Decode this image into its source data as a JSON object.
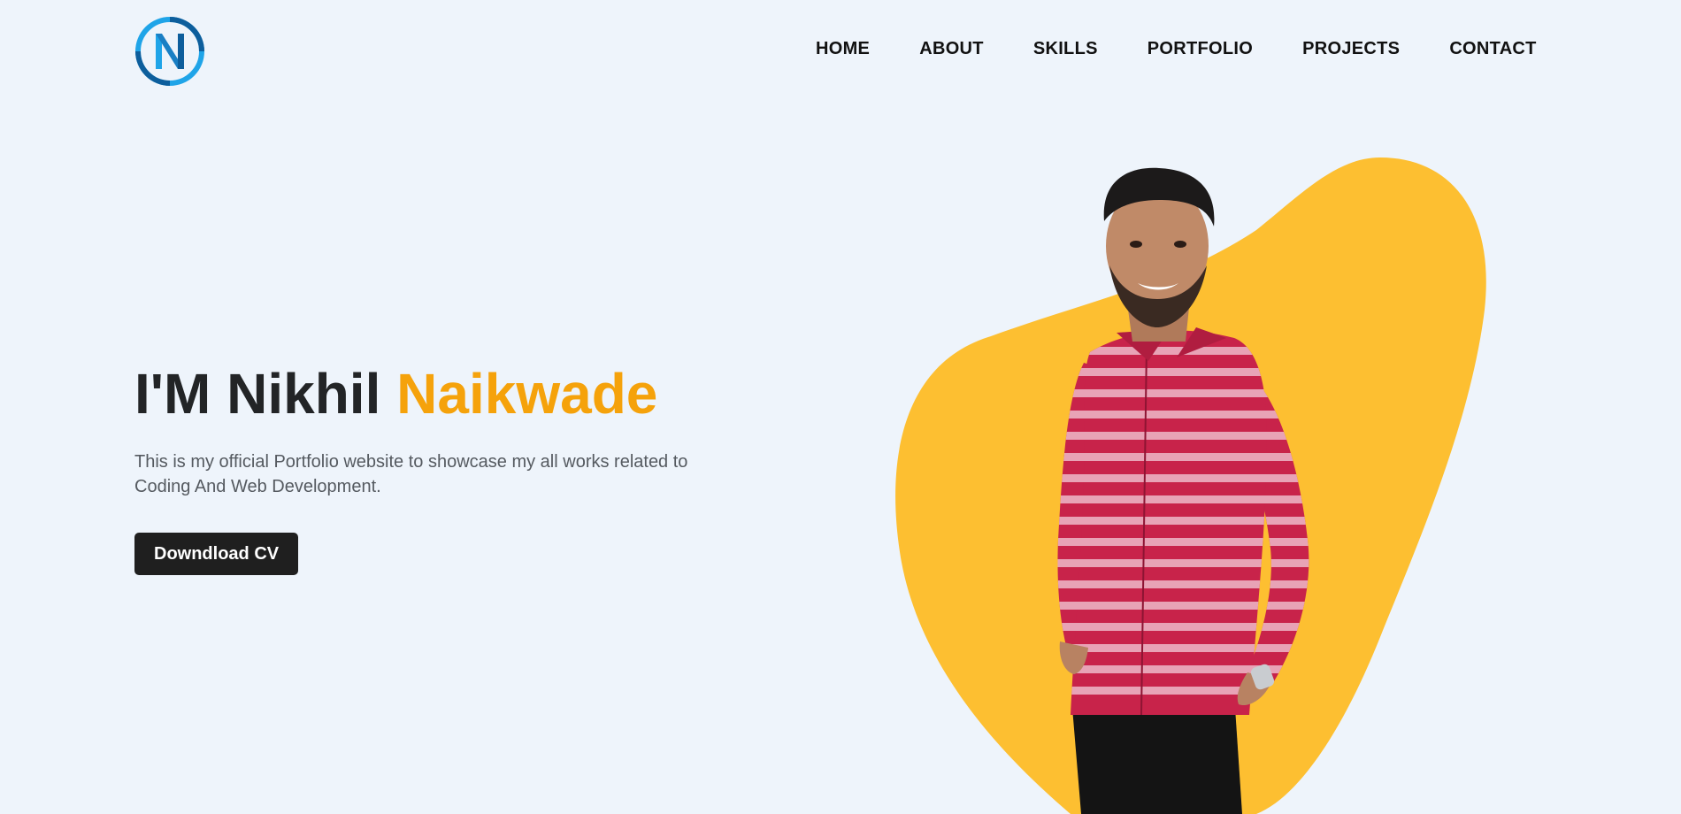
{
  "brand": {
    "logo_letter": "N",
    "colors": {
      "logo_light": "#1fa4e8",
      "logo_dark": "#0d5e9c"
    }
  },
  "nav": {
    "items": [
      {
        "label": "HOME"
      },
      {
        "label": "ABOUT"
      },
      {
        "label": "SKILLS"
      },
      {
        "label": "PORTFOLIO"
      },
      {
        "label": "PROJECTS"
      },
      {
        "label": "CONTACT"
      }
    ]
  },
  "hero": {
    "title_prefix": "I'M Nikhil",
    "title_highlight": "Naikwade",
    "description": "This is my official Portfolio website to showcase my all works related to Coding And Web Development.",
    "cta_label": "Downdload CV"
  },
  "colors": {
    "background": "#eef4fb",
    "accent": "#f5a20b",
    "blob": "#fdbf31",
    "shirt": "#c8234a",
    "button": "#1f1f1f"
  },
  "illustration": {
    "subject": "portrait-photo-person-red-striped-shirt"
  }
}
